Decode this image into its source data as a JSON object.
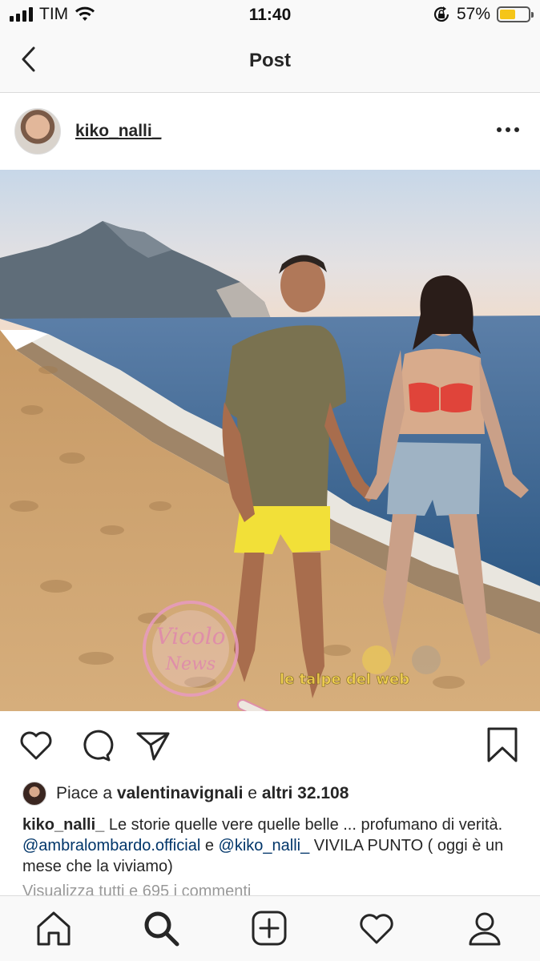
{
  "status_bar": {
    "carrier": "TIM",
    "time": "11:40",
    "battery_percent": "57%",
    "battery_level": 0.57,
    "battery_color": "#f5c518"
  },
  "header": {
    "title": "Post",
    "back_icon": "chevron-left-icon"
  },
  "post": {
    "username": "kiko_nalli_",
    "more_icon": "more-horizontal-icon",
    "photo_icon": "beach-photo",
    "actions": [
      "heart-icon",
      "comment-icon",
      "share-icon",
      "bookmark-icon"
    ],
    "likes": {
      "prefix": "Piace a",
      "user": "valentinavignali",
      "connector": "e",
      "others": "altri 32.108"
    },
    "caption": {
      "author": "kiko_nalli_",
      "text_1": " Le storie quelle vere quelle belle ... profumano di verità. ",
      "mention_1": "@ambralombardo.official",
      "text_2": " e ",
      "mention_2": "@kiko_nalli_",
      "text_3": "  VIVILA PUNTO ( oggi è un mese che la viviamo)"
    },
    "view_comments": "Visualizza tutti e 695 i commenti"
  },
  "tab_bar": {
    "items": [
      "home-icon",
      "search-icon",
      "add-post-icon",
      "activity-heart-icon",
      "profile-icon"
    ]
  },
  "colors": {
    "mention": "#003569",
    "text": "#262626",
    "muted": "#999999"
  }
}
